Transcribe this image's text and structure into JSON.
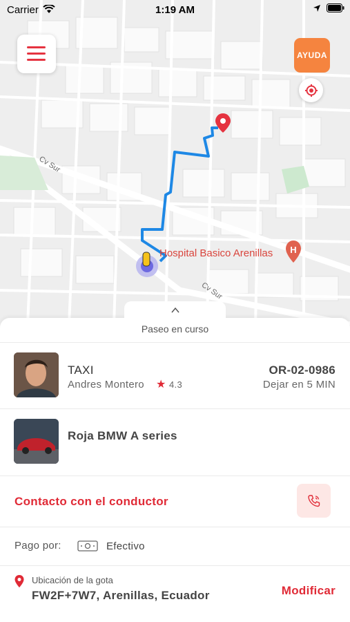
{
  "status_bar": {
    "carrier": "Carrier",
    "time": "1:19 AM"
  },
  "map": {
    "help_button": "AYUDA",
    "place_label": "Hospital Basico Arenillas",
    "road_labels": [
      "Cv Sur",
      "Cv Sur"
    ]
  },
  "sheet": {
    "ride_status": "Paseo en curso",
    "driver": {
      "service": "TAXI",
      "name": "Andres Montero",
      "rating": "4.3",
      "plate": "OR-02-0986",
      "eta": "Dejar en 5 MIN"
    },
    "vehicle": {
      "description": "Roja BMW A series"
    },
    "contact": {
      "label": "Contacto con el conductor"
    },
    "payment": {
      "label": "Pago por:",
      "method": "Efectivo"
    },
    "pickup": {
      "label": "Ubicación de la gota",
      "address": "FW2F+7W7, Arenillas, Ecuador",
      "modify": "Modificar"
    }
  },
  "colors": {
    "accent": "#e02a36",
    "help": "#f5843f",
    "route": "#1e88e5"
  }
}
